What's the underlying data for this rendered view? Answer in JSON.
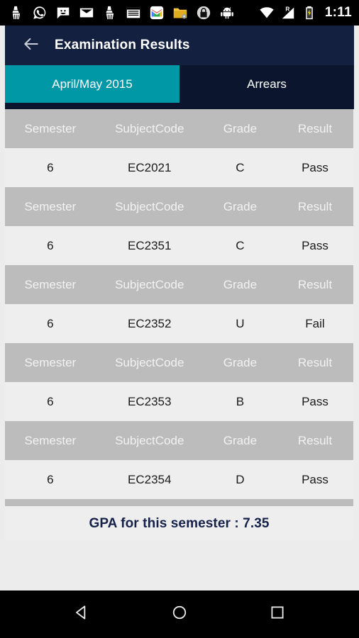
{
  "status_bar": {
    "time": "1:11",
    "left_icons": [
      {
        "name": "cleaner-icon"
      },
      {
        "name": "whatsapp-icon"
      },
      {
        "name": "messaging-icon"
      },
      {
        "name": "email-icon"
      },
      {
        "name": "cleaner-2-icon"
      },
      {
        "name": "news-icon"
      },
      {
        "name": "gmail-icon"
      },
      {
        "name": "folder-icon"
      },
      {
        "name": "lock-icon"
      },
      {
        "name": "android-icon"
      }
    ],
    "right_icons": [
      {
        "name": "wifi-icon"
      },
      {
        "name": "cellular-signal-roaming-icon",
        "label": "R"
      },
      {
        "name": "battery-charging-icon"
      }
    ]
  },
  "toolbar": {
    "back_label": "Back",
    "title": "Examination Results"
  },
  "tabs": [
    {
      "label": "April/May 2015",
      "active": true
    },
    {
      "label": "Arrears",
      "active": false
    }
  ],
  "table": {
    "columns": [
      "Semester",
      "SubjectCode",
      "Grade",
      "Result"
    ],
    "rows": [
      {
        "semester": "6",
        "subject_code": "EC2021",
        "grade": "C",
        "result": "Pass"
      },
      {
        "semester": "6",
        "subject_code": "EC2351",
        "grade": "C",
        "result": "Pass"
      },
      {
        "semester": "6",
        "subject_code": "EC2352",
        "grade": "U",
        "result": "Fail"
      },
      {
        "semester": "6",
        "subject_code": "EC2353",
        "grade": "B",
        "result": "Pass"
      },
      {
        "semester": "6",
        "subject_code": "EC2354",
        "grade": "D",
        "result": "Pass"
      }
    ]
  },
  "summary": {
    "gpa_text": "GPA for this semester : 7.35",
    "gpa_value": "7.35"
  },
  "nav_bar": {
    "back_label": "Back",
    "home_label": "Home",
    "recents_label": "Recents"
  },
  "colors": {
    "toolbar_navy": "#142040",
    "tabbar_navy": "#0b162e",
    "accent_teal": "#0097a7",
    "header_gray": "#bcbcbc",
    "row_gray": "#eeeeee",
    "page_gray": "#ececec",
    "gpa_navy": "#16214a"
  }
}
